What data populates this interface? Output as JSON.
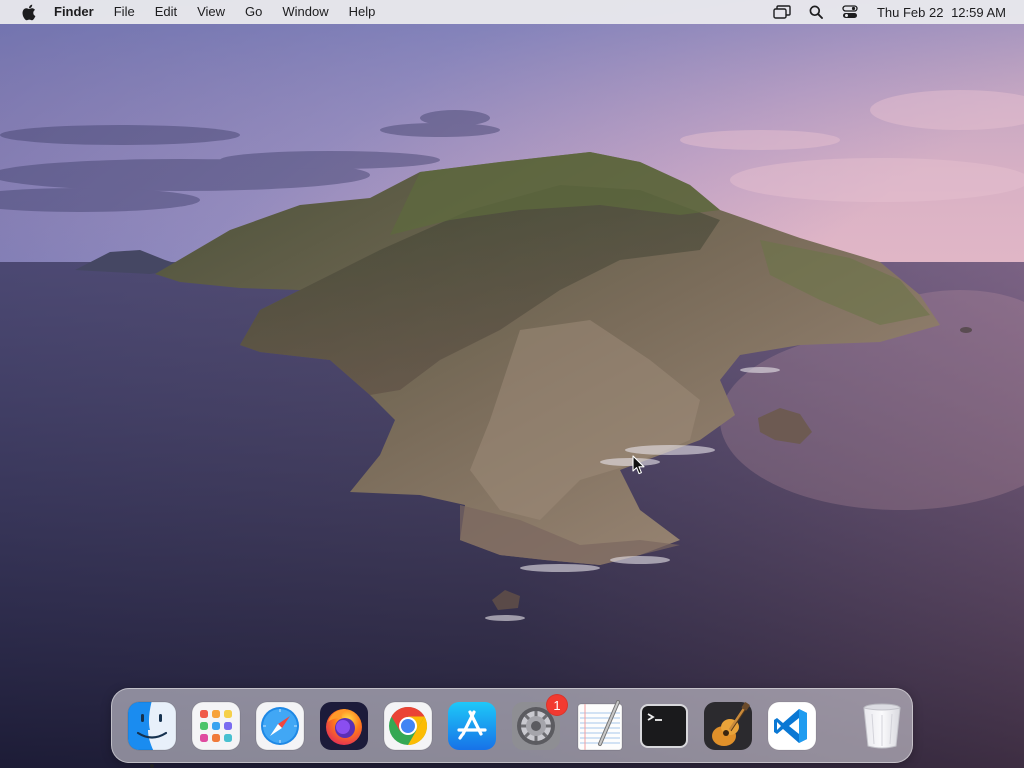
{
  "menubar": {
    "apple_icon": "apple-logo-icon",
    "app_name": "Finder",
    "menus": [
      "File",
      "Edit",
      "View",
      "Go",
      "Window",
      "Help"
    ],
    "status_icons": [
      "mission-control-icon",
      "spotlight-search-icon",
      "control-center-icon"
    ],
    "clock": {
      "date": "Thu Feb 22",
      "time": "12:59 AM"
    }
  },
  "desktop": {
    "wallpaper": "macOS Catalina island at dusk"
  },
  "dock": {
    "apps": [
      {
        "id": "finder",
        "name": "Finder",
        "icon": "finder-icon",
        "running": true
      },
      {
        "id": "launchpad",
        "name": "Launchpad",
        "icon": "launchpad-icon"
      },
      {
        "id": "safari",
        "name": "Safari",
        "icon": "safari-icon"
      },
      {
        "id": "firefox",
        "name": "Firefox",
        "icon": "firefox-icon"
      },
      {
        "id": "chrome",
        "name": "Google Chrome",
        "icon": "chrome-icon"
      },
      {
        "id": "app-store",
        "name": "App Store",
        "icon": "app-store-icon"
      },
      {
        "id": "system-preferences",
        "name": "System Preferences",
        "icon": "system-preferences-icon",
        "badge": "1"
      },
      {
        "id": "textedit",
        "name": "TextEdit",
        "icon": "textedit-icon"
      },
      {
        "id": "terminal",
        "name": "Terminal",
        "icon": "terminal-icon"
      },
      {
        "id": "garageband",
        "name": "GarageBand",
        "icon": "garageband-icon"
      },
      {
        "id": "vscode",
        "name": "Visual Studio Code",
        "icon": "vscode-icon"
      }
    ],
    "trash": {
      "name": "Trash",
      "icon": "trash-icon"
    }
  },
  "colors": {
    "menubar_bg": "#e8e8ec",
    "badge": "#f23a30",
    "safari_blue": "#1e88e5",
    "vscode_blue": "#0a78d4"
  }
}
